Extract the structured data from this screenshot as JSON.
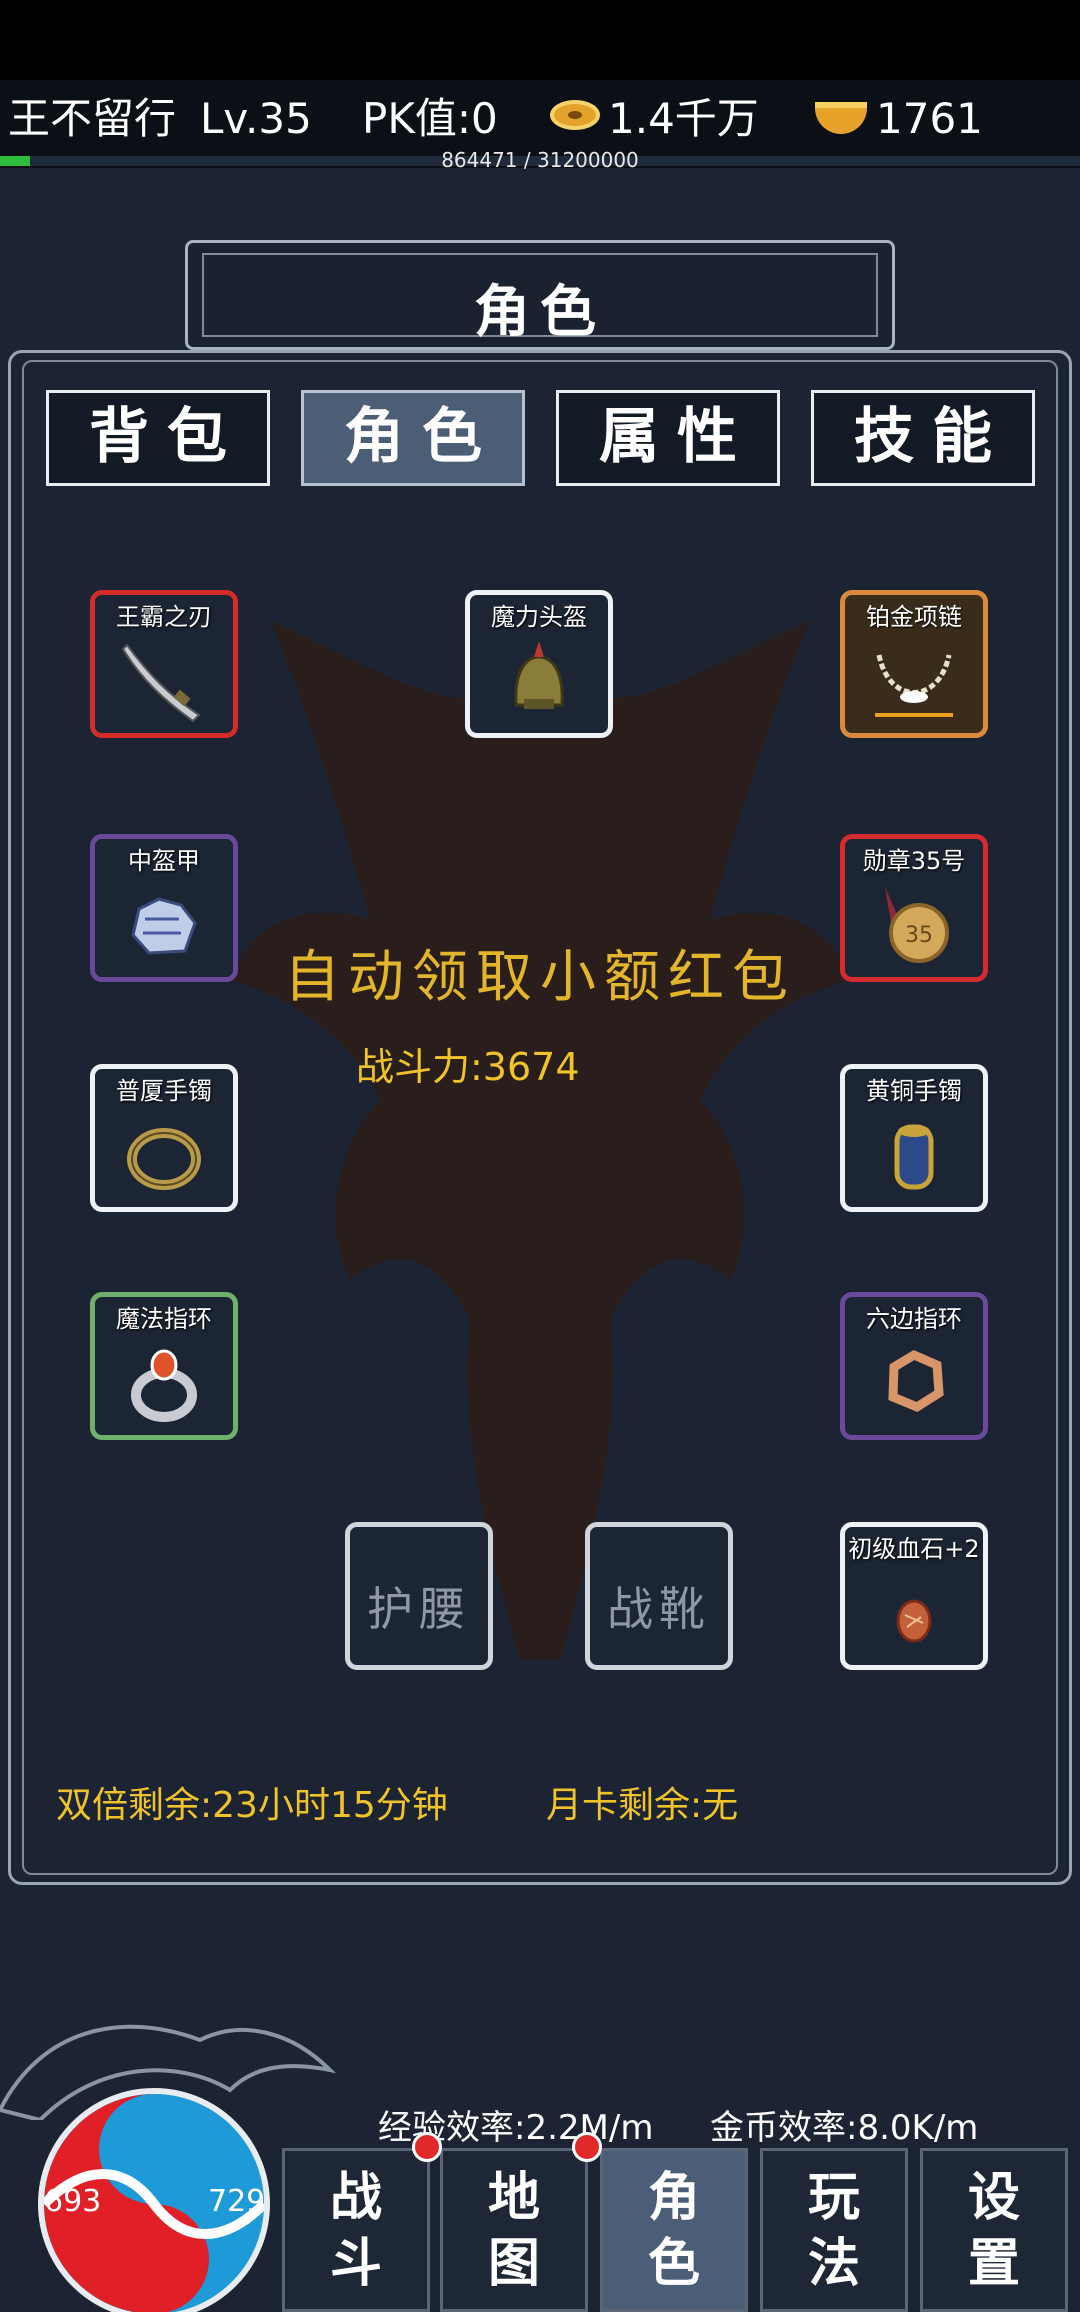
{
  "player": {
    "name": "王不留行",
    "level": "Lv.35",
    "pk": "PK值:0",
    "gold": "1.4千万",
    "ingot": "1761",
    "exp_text": "864471 / 31200000",
    "exp_fraction": 0.028
  },
  "panel": {
    "title": "角色"
  },
  "tabs": [
    {
      "label": "背包"
    },
    {
      "label": "角色"
    },
    {
      "label": "属性"
    },
    {
      "label": "技能"
    }
  ],
  "equipment": {
    "weapon": {
      "name": "王霸之刃",
      "quality": "red",
      "icon": "blade-icon"
    },
    "helmet": {
      "name": "魔力头盔",
      "quality": "white",
      "icon": "helmet-icon"
    },
    "necklace": {
      "name": "铂金项链",
      "quality": "orange",
      "icon": "necklace-icon"
    },
    "armor": {
      "name": "中盔甲",
      "quality": "purple",
      "icon": "armor-icon"
    },
    "medal": {
      "name": "勋章35号",
      "quality": "red",
      "icon": "medal-icon"
    },
    "bracelet_left": {
      "name": "普厦手镯",
      "quality": "white",
      "icon": "bracelet-icon"
    },
    "bracelet_right": {
      "name": "黄铜手镯",
      "quality": "white",
      "icon": "bracelet-icon"
    },
    "ring_left": {
      "name": "魔法指环",
      "quality": "green",
      "icon": "ring-icon"
    },
    "ring_right": {
      "name": "六边指环",
      "quality": "purple",
      "icon": "hex-ring-icon"
    },
    "belt": {
      "empty_label": "护腰"
    },
    "boots": {
      "empty_label": "战靴"
    },
    "gem": {
      "name": "初级血石+2",
      "quality": "white",
      "icon": "bloodstone-icon"
    }
  },
  "promo": "自动领取小额红包",
  "combat_power": "战斗力:3674",
  "double_exp": "双倍剩余:23小时15分钟",
  "month_card": "月卡剩余:无",
  "exp_rate": "经验效率:2.2M/m",
  "gold_rate": "金币效率:8.0K/m",
  "hp": "693",
  "mp": "729",
  "nav": [
    {
      "label": "战斗"
    },
    {
      "label": "地图"
    },
    {
      "label": "角色"
    },
    {
      "label": "玩法"
    },
    {
      "label": "设置"
    }
  ],
  "colors": {
    "gold_text": "#f0c428",
    "active_tab": "#4c5d76",
    "hp": "#e01f27",
    "mp": "#1e9ad8"
  }
}
